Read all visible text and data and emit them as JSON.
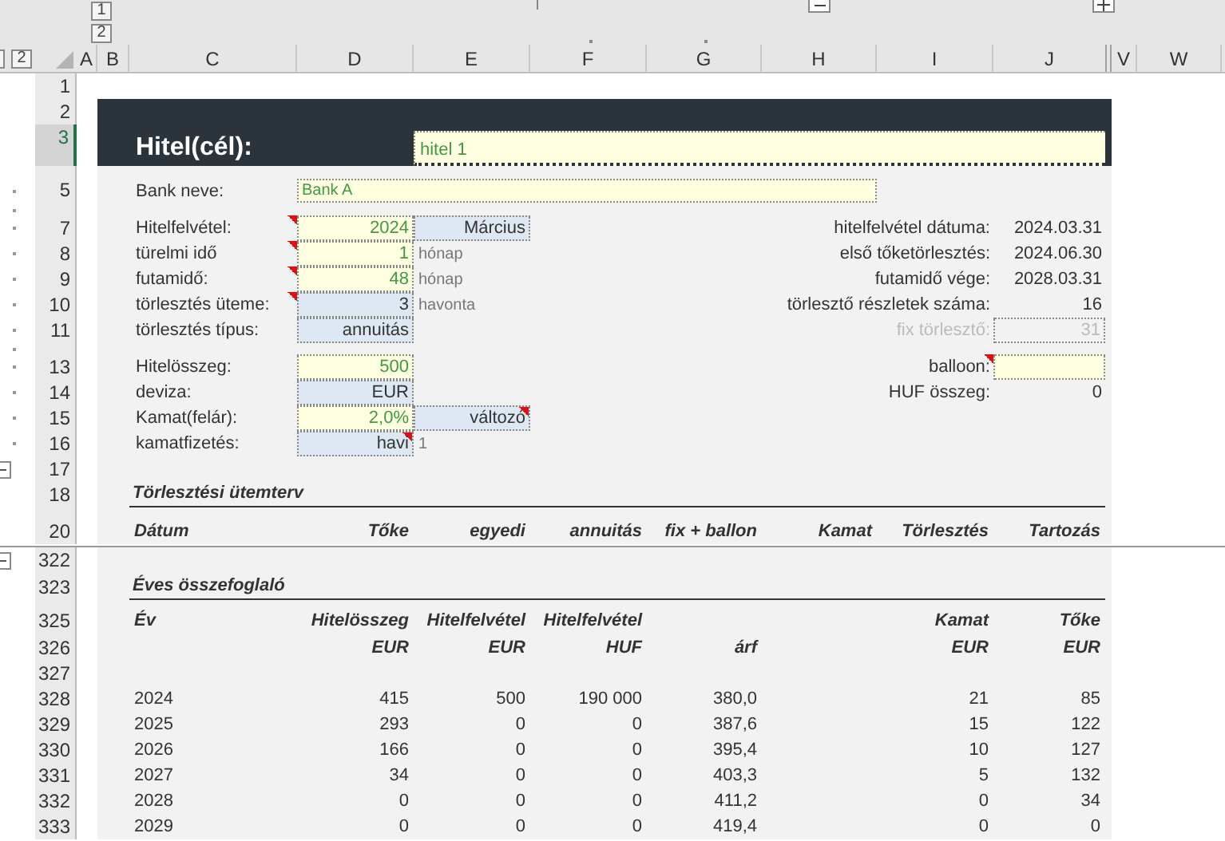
{
  "outline_buttons": {
    "columns": [
      "1",
      "2"
    ],
    "rows": [
      "2"
    ]
  },
  "column_headers": [
    "A",
    "B",
    "C",
    "D",
    "E",
    "F",
    "G",
    "H",
    "I",
    "J",
    "V",
    "W"
  ],
  "row_headers": [
    {
      "label": "1",
      "selected": false
    },
    {
      "label": "2",
      "selected": false
    },
    {
      "label": "3",
      "selected": true
    },
    {
      "label": "5",
      "selected": false
    },
    {
      "label": "7",
      "selected": false
    },
    {
      "label": "8",
      "selected": false
    },
    {
      "label": "9",
      "selected": false
    },
    {
      "label": "10",
      "selected": false
    },
    {
      "label": "11",
      "selected": false
    },
    {
      "label": "13",
      "selected": false
    },
    {
      "label": "14",
      "selected": false
    },
    {
      "label": "15",
      "selected": false
    },
    {
      "label": "16",
      "selected": false
    },
    {
      "label": "17",
      "selected": false
    },
    {
      "label": "18",
      "selected": false
    },
    {
      "label": "20",
      "selected": false
    },
    {
      "label": "322",
      "selected": false
    },
    {
      "label": "323",
      "selected": false
    },
    {
      "label": "325",
      "selected": false
    },
    {
      "label": "326",
      "selected": false
    },
    {
      "label": "327",
      "selected": false
    },
    {
      "label": "328",
      "selected": false
    },
    {
      "label": "329",
      "selected": false
    },
    {
      "label": "330",
      "selected": false
    },
    {
      "label": "331",
      "selected": false
    },
    {
      "label": "332",
      "selected": false
    },
    {
      "label": "333",
      "selected": false
    }
  ],
  "title": {
    "label": "Hitel(cél):",
    "value": "hitel 1"
  },
  "bank": {
    "label": "Bank neve:",
    "value": "Bank A"
  },
  "loan_inputs": [
    {
      "label": "Hitelfelvétel:",
      "label_comment": true,
      "value": "2024",
      "kind": "input",
      "value_comment": false,
      "extra": {
        "value": "Március",
        "kind": "list",
        "comment": false
      }
    },
    {
      "label": "türelmi idő",
      "label_comment": true,
      "value": "1",
      "kind": "input",
      "value_comment": false,
      "unit": "hónap"
    },
    {
      "label": "futamidő:",
      "label_comment": true,
      "value": "48",
      "kind": "input",
      "value_comment": false,
      "unit": "hónap"
    },
    {
      "label": "törlesztés üteme:",
      "label_comment": true,
      "value": "3",
      "kind": "list",
      "value_comment": false,
      "unit": "havonta"
    },
    {
      "label": "törlesztés típus:",
      "label_comment": false,
      "value": "annuitás",
      "kind": "list",
      "value_comment": false
    },
    {
      "label": "Hitelösszeg:",
      "label_comment": false,
      "value": "500",
      "kind": "input",
      "value_comment": false
    },
    {
      "label": "deviza:",
      "label_comment": false,
      "value": "EUR",
      "kind": "list",
      "value_comment": false
    },
    {
      "label": "Kamat(felár):",
      "label_comment": false,
      "value": "2,0%",
      "kind": "input",
      "value_comment": false,
      "extra": {
        "value": "változó",
        "kind": "list",
        "comment": true
      }
    },
    {
      "label": "kamatfizetés:",
      "label_comment": false,
      "value": "havi",
      "kind": "list",
      "value_comment": true,
      "unit": "1"
    }
  ],
  "loan_summary": [
    {
      "label": "hitelfelvétel dátuma:",
      "value": "2024.03.31",
      "kind": "text",
      "disabled": false,
      "label_comment": false
    },
    {
      "label": "első tőketörlesztés:",
      "value": "2024.06.30",
      "kind": "text",
      "disabled": false,
      "label_comment": false
    },
    {
      "label": "futamidő vége:",
      "value": "2028.03.31",
      "kind": "text",
      "disabled": false,
      "label_comment": false
    },
    {
      "label": "törlesztő részletek száma:",
      "value": "16",
      "kind": "text",
      "disabled": false,
      "label_comment": false
    },
    {
      "label": "fix törlesztő:",
      "value": "31",
      "kind": "field",
      "disabled": true,
      "label_comment": false
    },
    {
      "label": "balloon:",
      "kind": "input",
      "disabled": false,
      "label_comment": true
    },
    {
      "label": "HUF összeg:",
      "value": "0",
      "kind": "text",
      "disabled": false,
      "label_comment": false
    }
  ],
  "schedule": {
    "title": "Törlesztési ütemterv",
    "columns": [
      "Dátum",
      "Tőke",
      "egyedi",
      "annuitás",
      "fix + ballon",
      "Kamat",
      "Törlesztés",
      "Tartozás"
    ]
  },
  "annual_summary": {
    "title": "Éves összefoglaló",
    "columns": [
      {
        "name": "Év"
      },
      {
        "name": "Hitelösszeg",
        "unit": "EUR"
      },
      {
        "name": "Hitelfelvétel",
        "unit": "EUR"
      },
      {
        "name": "Hitelfelvétel",
        "unit": "HUF"
      },
      {
        "unit": "árf"
      },
      {
        "name": "Kamat",
        "unit": "EUR"
      },
      {
        "name": "Tőke",
        "unit": "EUR"
      }
    ],
    "rows": [
      [
        "2024",
        "415",
        "500",
        "190 000",
        "380,0",
        "21",
        "85"
      ],
      [
        "2025",
        "293",
        "0",
        "0",
        "387,6",
        "15",
        "122"
      ],
      [
        "2026",
        "166",
        "0",
        "0",
        "395,4",
        "10",
        "127"
      ],
      [
        "2027",
        "34",
        "0",
        "0",
        "403,3",
        "5",
        "132"
      ],
      [
        "2028",
        "0",
        "0",
        "0",
        "411,2",
        "0",
        "34"
      ],
      [
        "2029",
        "0",
        "0",
        "0",
        "419,4",
        "0",
        "0"
      ]
    ]
  }
}
